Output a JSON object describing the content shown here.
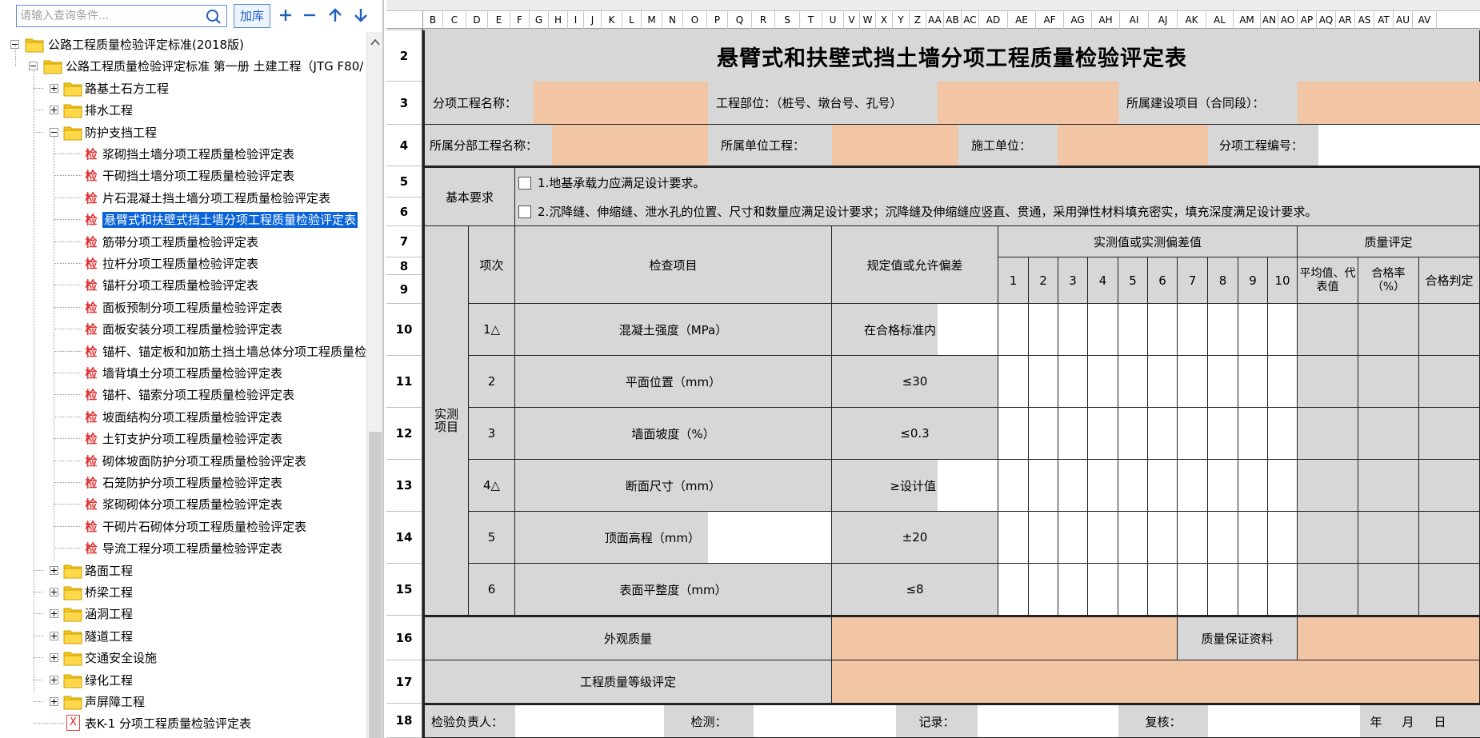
{
  "toolbar": {
    "search_placeholder": "请输入查询条件...",
    "add_button": "加库",
    "icons": [
      "search-icon",
      "plus-icon",
      "minus-icon",
      "arrow-up-icon",
      "arrow-down-icon"
    ]
  },
  "tree": {
    "root": "公路工程质量检验评定标准(2018版)",
    "volume": "公路工程质量检验评定标准 第一册 土建工程（JTG F80/",
    "items": [
      {
        "label": "路基土石方工程",
        "kind": "folder",
        "state": "collapsed"
      },
      {
        "label": "排水工程",
        "kind": "folder",
        "state": "collapsed"
      },
      {
        "label": "防护支挡工程",
        "kind": "folder",
        "state": "expanded"
      },
      {
        "label": "浆砌挡土墙分项工程质量检验评定表",
        "kind": "form"
      },
      {
        "label": "干砌挡土墙分项工程质量检验评定表",
        "kind": "form"
      },
      {
        "label": "片石混凝土挡土墙分项工程质量检验评定表",
        "kind": "form"
      },
      {
        "label": "悬臂式和扶壁式挡土墙分项工程质量检验评定表",
        "kind": "form",
        "selected": true
      },
      {
        "label": "筋带分项工程质量检验评定表",
        "kind": "form"
      },
      {
        "label": "拉杆分项工程质量检验评定表",
        "kind": "form"
      },
      {
        "label": "锚杆分项工程质量检验评定表",
        "kind": "form"
      },
      {
        "label": "面板预制分项工程质量检验评定表",
        "kind": "form"
      },
      {
        "label": "面板安装分项工程质量检验评定表",
        "kind": "form"
      },
      {
        "label": "锚杆、锚定板和加筋土挡土墙总体分项工程质量检",
        "kind": "form"
      },
      {
        "label": "墙背填土分项工程质量检验评定表",
        "kind": "form"
      },
      {
        "label": "锚杆、锚索分项工程质量检验评定表",
        "kind": "form"
      },
      {
        "label": "坡面结构分项工程质量检验评定表",
        "kind": "form"
      },
      {
        "label": "土钉支护分项工程质量检验评定表",
        "kind": "form"
      },
      {
        "label": "砌体坡面防护分项工程质量检验评定表",
        "kind": "form"
      },
      {
        "label": "石笼防护分项工程质量检验评定表",
        "kind": "form"
      },
      {
        "label": "浆砌砌体分项工程质量检验评定表",
        "kind": "form"
      },
      {
        "label": "干砌片石砌体分项工程质量检验评定表",
        "kind": "form"
      },
      {
        "label": "导流工程分项工程质量检验评定表",
        "kind": "form"
      },
      {
        "label": "路面工程",
        "kind": "folder",
        "state": "collapsed"
      },
      {
        "label": "桥梁工程",
        "kind": "folder",
        "state": "collapsed"
      },
      {
        "label": "涵洞工程",
        "kind": "folder",
        "state": "collapsed"
      },
      {
        "label": "隧道工程",
        "kind": "folder",
        "state": "collapsed"
      },
      {
        "label": "交通安全设施",
        "kind": "folder",
        "state": "collapsed"
      },
      {
        "label": "绿化工程",
        "kind": "folder",
        "state": "collapsed"
      },
      {
        "label": "声屏障工程",
        "kind": "folder",
        "state": "collapsed"
      },
      {
        "label": "表K-1 分项工程质量检验评定表",
        "kind": "xform"
      }
    ],
    "form_icon_char": "检",
    "xform_icon_char": "X"
  },
  "sheet": {
    "columns": [
      "B",
      "C",
      "D",
      "E",
      "F",
      "G",
      "H",
      "I",
      "J",
      "K",
      "L",
      "M",
      "N",
      "O",
      "P",
      "Q",
      "R",
      "S",
      "T",
      "U",
      "V",
      "W",
      "X",
      "Y",
      "Z",
      "AA",
      "AB",
      "AC",
      "AD",
      "AE",
      "AF",
      "AG",
      "AH",
      "AI",
      "AJ",
      "AK",
      "AL",
      "AM",
      "AN",
      "AO",
      "AP",
      "AQ",
      "AR",
      "AS",
      "AT",
      "AU",
      "AV"
    ],
    "rows": [
      "2",
      "3",
      "4",
      "5",
      "6",
      "7",
      "8",
      "9",
      "10",
      "11",
      "12",
      "13",
      "14",
      "15",
      "16",
      "17",
      "18"
    ],
    "title": "悬臂式和扶壁式挡土墙分项工程质量检验评定表",
    "header": {
      "item_name": "分项工程名称：",
      "location": "工程部位：（桩号、墩台号、孔号）",
      "project": "所属建设项目（合同段）：",
      "subpart": "所属分部工程名称：",
      "unit": "所属单位工程：",
      "contractor": "施工单位：",
      "code": "分项工程编号："
    },
    "basic": {
      "label": "基本要求",
      "req1": "1.地基承载力应满足设计要求。",
      "req2": "2.沉降缝、伸缩缝、泄水孔的位置、尺寸和数量应满足设计要求；沉降缝及伸缩缝应竖直、贯通，采用弹性材料填充密实，填充深度满足设计要求。"
    },
    "table": {
      "measured_group": "实测\n项目",
      "seq": "项次",
      "check_item": "检查项目",
      "spec": "规定值或允许偏差",
      "measured": "实测值或实测偏差值",
      "quality": "质量评定",
      "points": [
        "1",
        "2",
        "3",
        "4",
        "5",
        "6",
        "7",
        "8",
        "9",
        "10"
      ],
      "avg": "平均值、代表值",
      "rate": "合格率（%）",
      "judge": "合格判定",
      "rows": [
        {
          "seq": "1△",
          "item": "混凝土强度（MPa）",
          "spec": "在合格标准内"
        },
        {
          "seq": "2",
          "item": "平面位置（mm）",
          "spec": "≤30"
        },
        {
          "seq": "3",
          "item": "墙面坡度（%）",
          "spec": "≤0.3"
        },
        {
          "seq": "4△",
          "item": "断面尺寸（mm）",
          "spec": "≥设计值"
        },
        {
          "seq": "5",
          "item": "顶面高程（mm）",
          "spec": "±20"
        },
        {
          "seq": "6",
          "item": "表面平整度（mm）",
          "spec": "≤8"
        }
      ]
    },
    "appearance": "外观质量",
    "docs": "质量保证资料",
    "grade": "工程质量等级评定",
    "footer": {
      "inspector": "检验负责人：",
      "tester": "检测：",
      "recorder": "记录：",
      "reviewer": "复核：",
      "year": "年",
      "month": "月",
      "day": "日"
    },
    "colors": {
      "peach": "#f2c5a4",
      "gray": "#d7d7d7",
      "selected": "#0a64d8",
      "folder": "#f5c518"
    }
  }
}
